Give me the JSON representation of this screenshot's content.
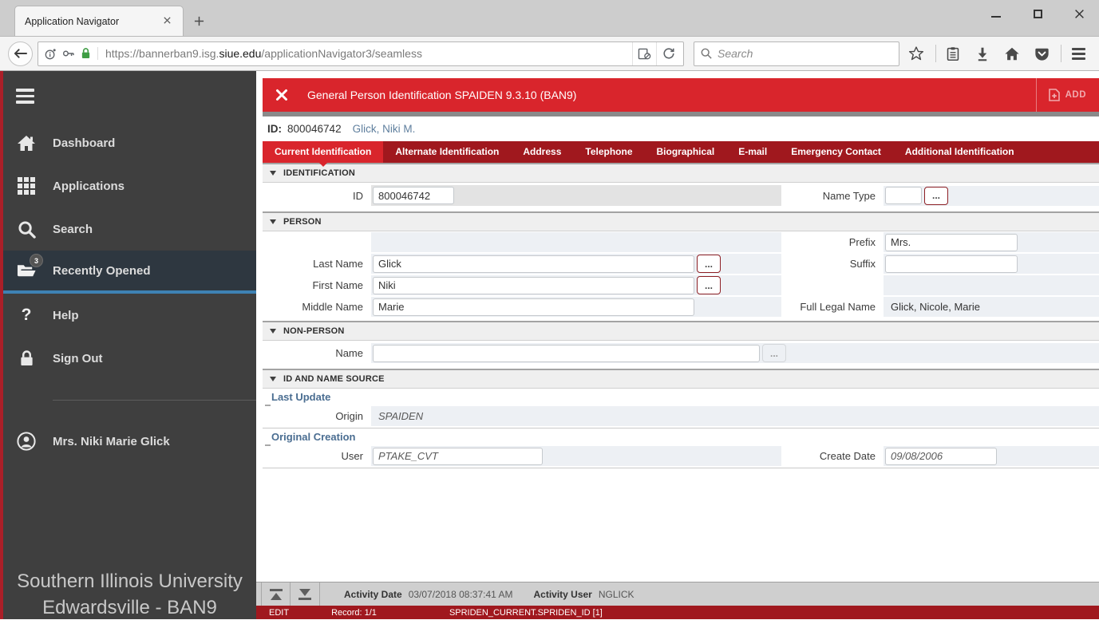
{
  "browser": {
    "tab_title": "Application Navigator",
    "search_placeholder": "Search",
    "url": {
      "scheme": "https://",
      "subdomain": "bannerban9.isg.",
      "domain": "siue.edu",
      "path": "/applicationNavigator3/seamless"
    }
  },
  "sidebar": {
    "items": [
      {
        "label": "Dashboard"
      },
      {
        "label": "Applications"
      },
      {
        "label": "Search"
      },
      {
        "label": "Recently Opened",
        "badge": "3"
      },
      {
        "label": "Help"
      },
      {
        "label": "Sign Out"
      }
    ],
    "help_glyph": "?",
    "user_name": "Mrs. Niki Marie Glick",
    "footer_line1": "Southern Illinois University",
    "footer_line2": "Edwardsville - BAN9"
  },
  "form": {
    "title": "General Person Identification SPAIDEN 9.3.10 (BAN9)",
    "add_label": "ADD",
    "lookup_glyph": "...",
    "key": {
      "id_label": "ID:",
      "id_value": "800046742",
      "name": "Glick, Niki M."
    },
    "tabs": [
      "Current Identification",
      "Alternate Identification",
      "Address",
      "Telephone",
      "Biographical",
      "E-mail",
      "Emergency Contact",
      "Additional Identification"
    ],
    "identification": {
      "title": "IDENTIFICATION",
      "id_label": "ID",
      "id_value": "800046742",
      "name_type_label": "Name Type",
      "name_type_value": ""
    },
    "person": {
      "title": "PERSON",
      "last_name_label": "Last Name",
      "last_name": "Glick",
      "first_name_label": "First Name",
      "first_name": "Niki",
      "middle_name_label": "Middle Name",
      "middle_name": "Marie",
      "prefix_label": "Prefix",
      "prefix": "Mrs.",
      "suffix_label": "Suffix",
      "suffix": "",
      "full_legal_name_label": "Full Legal Name",
      "full_legal_name": "Glick, Nicole, Marie"
    },
    "non_person": {
      "title": "NON-PERSON",
      "name_label": "Name",
      "name": ""
    },
    "id_name_source": {
      "title": "ID AND NAME SOURCE",
      "last_update_title": "Last Update",
      "origin_label": "Origin",
      "origin_value": "SPAIDEN",
      "original_creation_title": "Original Creation",
      "user_label": "User",
      "user_value": "PTAKE_CVT",
      "create_date_label": "Create Date",
      "create_date_value": "09/08/2006"
    }
  },
  "statusbar": {
    "activity_date_label": "Activity Date",
    "activity_date_value": "03/07/2018 08:37:41 AM",
    "activity_user_label": "Activity User",
    "activity_user_value": "NGLICK",
    "mode": "EDIT",
    "record": "Record: 1/1",
    "field_reference": "SPRIDEN_CURRENT.SPRIDEN_ID [1]"
  },
  "colors": {
    "banner_red": "#d9252c",
    "banner_maroon": "#a0181e",
    "sidebar_bg": "#3f3f3f",
    "active_item_bg": "#2e3740",
    "accent_blue": "#3e82b4",
    "lock_green": "#3f9d44"
  }
}
